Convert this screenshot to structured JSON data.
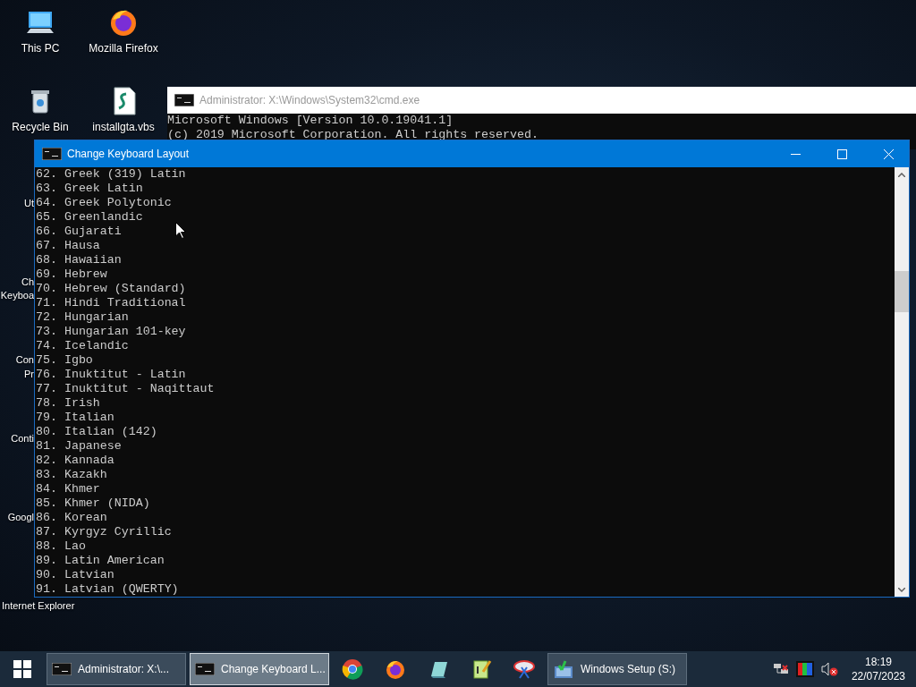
{
  "desktop_icons": [
    {
      "label": "This PC",
      "kind": "pc"
    },
    {
      "label": "Mozilla Firefox",
      "kind": "firefox"
    },
    {
      "label": "Recycle Bin",
      "kind": "bin"
    },
    {
      "label": "installgta.vbs",
      "kind": "script"
    }
  ],
  "covered_labels": [
    "Ut",
    "Ch",
    "Keyboa",
    "Con",
    "Pr",
    "Conti",
    "Googl",
    "Internet Explorer"
  ],
  "back_window": {
    "title": "Administrator: X:\\Windows\\System32\\cmd.exe",
    "lines": [
      "Microsoft Windows [Version 10.0.19041.1]",
      "(c) 2019 Microsoft Corporation. All rights reserved."
    ]
  },
  "front_window": {
    "title": "Change Keyboard Layout",
    "lines": [
      "62. Greek (319) Latin",
      "63. Greek Latin",
      "64. Greek Polytonic",
      "65. Greenlandic",
      "66. Gujarati",
      "67. Hausa",
      "68. Hawaiian",
      "69. Hebrew",
      "70. Hebrew (Standard)",
      "71. Hindi Traditional",
      "72. Hungarian",
      "73. Hungarian 101-key",
      "74. Icelandic",
      "75. Igbo",
      "76. Inuktitut - Latin",
      "77. Inuktitut - Naqittaut",
      "78. Irish",
      "79. Italian",
      "80. Italian (142)",
      "81. Japanese",
      "82. Kannada",
      "83. Kazakh",
      "84. Khmer",
      "85. Khmer (NIDA)",
      "86. Korean",
      "87. Kyrgyz Cyrillic",
      "88. Lao",
      "89. Latin American",
      "90. Latvian",
      "91. Latvian (QWERTY)"
    ]
  },
  "taskbar": {
    "items": [
      {
        "kind": "console",
        "label": "Administrator: X:\\...",
        "selected": false
      },
      {
        "kind": "console",
        "label": "Change Keyboard L...",
        "selected": true
      },
      {
        "kind": "chrome"
      },
      {
        "kind": "firefox"
      },
      {
        "kind": "notebook"
      },
      {
        "kind": "notepad"
      },
      {
        "kind": "snip"
      },
      {
        "kind": "setup",
        "label": "Windows Setup (S:)",
        "selected": false
      }
    ],
    "clock": {
      "time": "18:19",
      "date": "22/07/2023"
    }
  }
}
